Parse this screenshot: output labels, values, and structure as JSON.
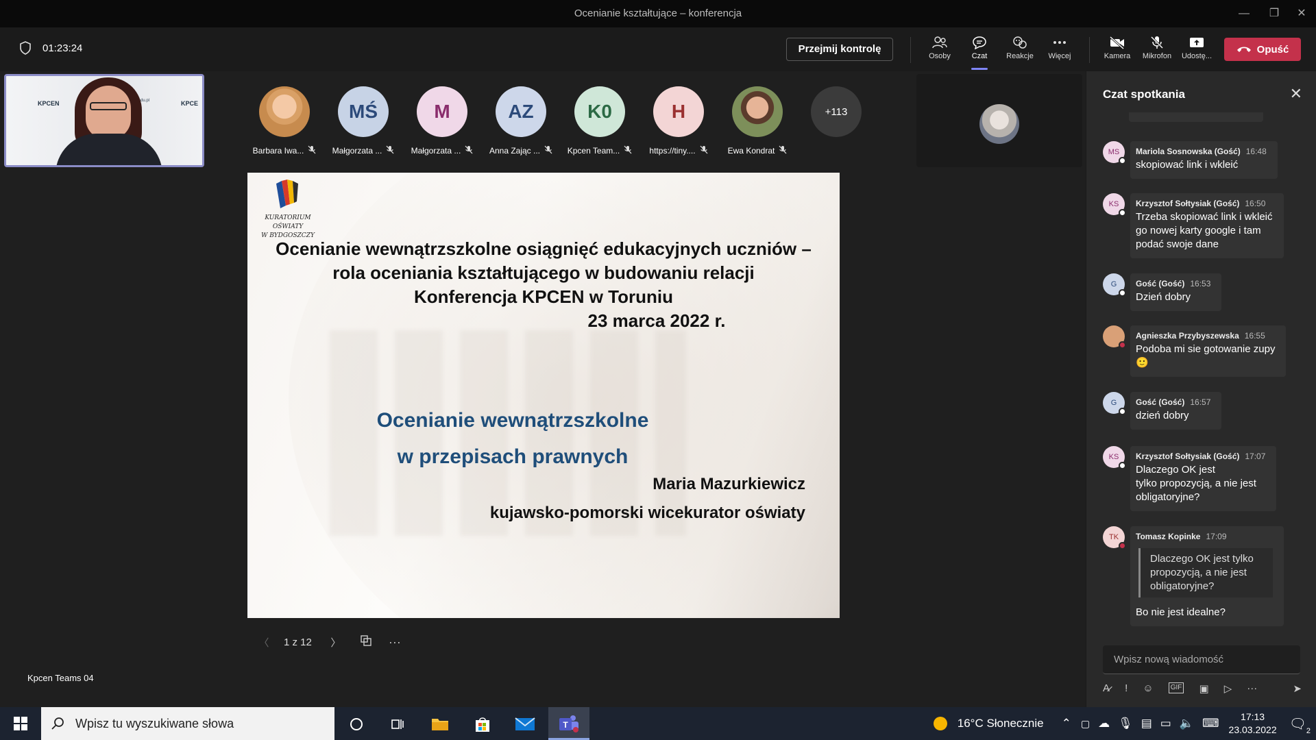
{
  "window": {
    "title": "Ocenianie kształtujące – konferencja"
  },
  "toolbar": {
    "elapsed": "01:23:24",
    "take_control": "Przejmij kontrolę",
    "buttons": {
      "people": "Osoby",
      "chat": "Czat",
      "reactions": "Reakcje",
      "more": "Więcej",
      "camera": "Kamera",
      "mic": "Mikrofon",
      "share": "Udostę..."
    },
    "leave": "Opuść",
    "leave_color": "#c4314b"
  },
  "self_view": {
    "logo_left": "KPCEN",
    "logo_right": "KPCE",
    "url": "www.kpcen-torun.edu.pl",
    "caption": "Kpcen Teams 04"
  },
  "participants": [
    {
      "initials": "",
      "name": "Barbara Iwa...",
      "photo": true,
      "bg": "",
      "fg": ""
    },
    {
      "initials": "MŚ",
      "name": "Małgorzata ...",
      "photo": false,
      "bg": "#c7d3e6",
      "fg": "#2c4a7a"
    },
    {
      "initials": "M",
      "name": "Małgorzata ...",
      "photo": false,
      "bg": "#f0d8e8",
      "fg": "#8a2d6c"
    },
    {
      "initials": "AZ",
      "name": "Anna Zając ...",
      "photo": false,
      "bg": "#cdd7ea",
      "fg": "#2c4a7a"
    },
    {
      "initials": "K0",
      "name": "Kpcen Team...",
      "photo": false,
      "bg": "#cfe7d8",
      "fg": "#2c6a45"
    },
    {
      "initials": "H",
      "name": "https://tiny....",
      "photo": false,
      "bg": "#f3d5d5",
      "fg": "#9a3030"
    },
    {
      "initials": "",
      "name": "Ewa Kondrat",
      "photo": true,
      "bg": "",
      "fg": ""
    }
  ],
  "more_participants": "+113",
  "slide": {
    "logo_caption_1": "KURATORIUM OŚWIATY",
    "logo_caption_2": "W BYDGOSZCZY",
    "title_1": "Ocenianie wewnątrzszkolne osiągnięć edukacyjnych uczniów –",
    "title_2": "rola oceniania kształtującego w budowaniu relacji",
    "title_3": "Konferencja KPCEN w Toruniu",
    "date": "23 marca 2022 r.",
    "subtitle_1": "Ocenianie wewnątrzszkolne",
    "subtitle_2": "w przepisach prawnych",
    "author": "Maria Mazurkiewicz",
    "author_role": "kujawsko-pomorski wicekurator oświaty",
    "subtitle_color": "#1f4e7a"
  },
  "slide_nav": {
    "page": "1 z 12"
  },
  "chat": {
    "title": "Czat spotkania",
    "messages": [
      {
        "initials": "MS",
        "author": "Mariola Sosnowska (Gość)",
        "time": "16:48",
        "lines": [
          "skopiować link i wkleić"
        ],
        "status": "white",
        "bg": "#f0d8e8",
        "fg": "#8a2d6c"
      },
      {
        "initials": "KS",
        "author": "Krzysztof Sołtysiak (Gość)",
        "time": "16:50",
        "lines": [
          "Trzeba skopiować link i wkleić",
          "go nowej karty google i tam",
          "podać swoje dane"
        ],
        "status": "white",
        "bg": "#f0d8e8",
        "fg": "#8a2d6c"
      },
      {
        "initials": "G",
        "author": "Gość (Gość)",
        "time": "16:53",
        "lines": [
          "Dzień dobry"
        ],
        "status": "white",
        "bg": "#cdd7ea",
        "fg": "#2c4a7a"
      },
      {
        "initials": "",
        "author": "Agnieszka Przybyszewska",
        "time": "16:55",
        "lines": [
          "Podoba mi sie gotowanie zupy",
          "🙂"
        ],
        "status": "red",
        "bg": "#d9a077",
        "fg": "#fff"
      },
      {
        "initials": "G",
        "author": "Gość (Gość)",
        "time": "16:57",
        "lines": [
          "dzień dobry"
        ],
        "status": "white",
        "bg": "#cdd7ea",
        "fg": "#2c4a7a"
      },
      {
        "initials": "KS",
        "author": "Krzysztof Sołtysiak (Gość)",
        "time": "17:07",
        "lines": [
          "Dlaczego OK jest",
          "tylko propozycją, a nie jest",
          "obligatoryjne?"
        ],
        "status": "white",
        "bg": "#f0d8e8",
        "fg": "#8a2d6c"
      },
      {
        "initials": "TK",
        "author": "Tomasz Kopinke",
        "time": "17:09",
        "quote": [
          "Dlaczego OK jest tylko",
          "propozycją, a nie jest",
          "obligatoryjne?"
        ],
        "lines": [
          "Bo nie jest idealne?"
        ],
        "status": "red",
        "bg": "#f3d5d5",
        "fg": "#9a3030"
      }
    ],
    "compose_placeholder": "Wpisz nową wiadomość"
  },
  "taskbar": {
    "search_placeholder": "Wpisz tu wyszukiwane słowa",
    "weather": "16°C  Słonecznie",
    "time": "17:13",
    "date": "23.03.2022",
    "notifications": "2"
  }
}
